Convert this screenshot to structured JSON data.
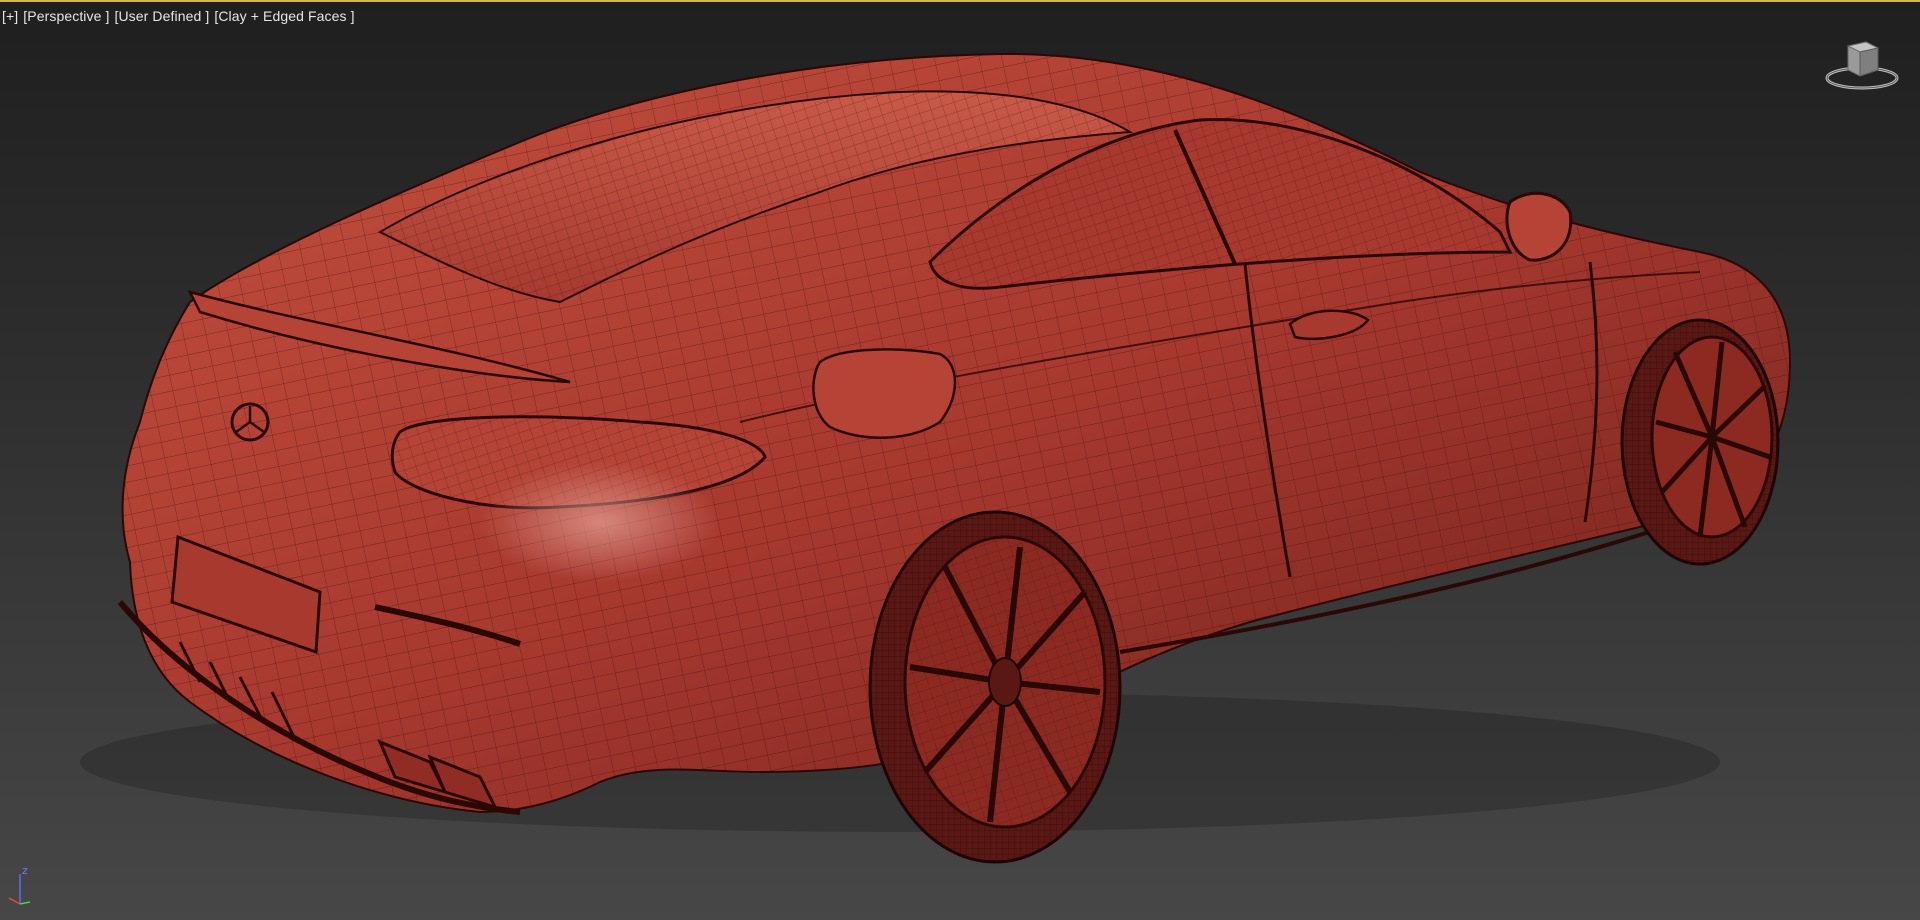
{
  "viewport": {
    "labels": {
      "menu": "[+]",
      "view": "[Perspective ]",
      "shading_preset": "[User Defined ]",
      "shading_mode": "[Clay + Edged Faces ]"
    },
    "axis_label": "z"
  },
  "colors": {
    "active_border": "#d8b24a",
    "clay_base": "#b8463c",
    "clay_shadow": "#7a2620",
    "wire_lines": "#3a0f0c",
    "background_top": "#1f1f1f",
    "background_bottom": "#474747"
  },
  "icons": {
    "viewcube": "viewcube-icon",
    "axis": "axis-tripod-icon"
  }
}
